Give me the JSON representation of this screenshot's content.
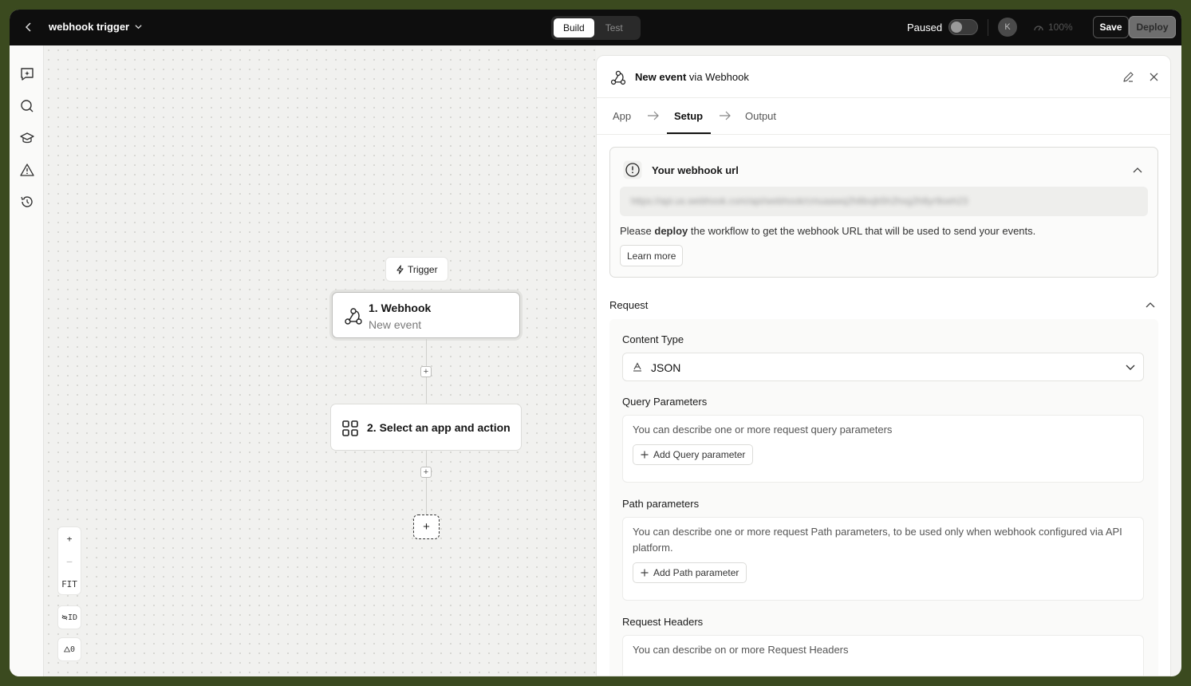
{
  "topbar": {
    "workflow_title": "webhook trigger",
    "modes": [
      "Build",
      "Test"
    ],
    "active_mode": "Build",
    "paused_label": "Paused",
    "paused": false,
    "avatar_initial": "K",
    "zoom_level": "100%",
    "save_label": "Save",
    "deploy_label": "Deploy"
  },
  "rail": {
    "items": [
      "ai-chat-icon",
      "search-icon",
      "learn-icon",
      "warning-icon",
      "history-icon"
    ]
  },
  "canvas": {
    "trigger_chip": "Trigger",
    "nodes": [
      {
        "title": "1. Webhook",
        "subtitle": "New event"
      },
      {
        "title": "2. Select an app and action",
        "subtitle": ""
      }
    ],
    "plus": "+",
    "controls": {
      "zoom_in": "+",
      "zoom_out": "—",
      "fit": "FIT",
      "id_toggle": "ID",
      "warnings": "0"
    }
  },
  "panel": {
    "title_prefix": "New event",
    "title_via": " via ",
    "title_app": "Webhook",
    "tabs": [
      "App",
      "Setup",
      "Output"
    ],
    "active_tab": "Setup",
    "webhook": {
      "heading": "Your webhook url",
      "url_masked": "https://api.us.webhook.com/api/webhook/cmuaawq2h8bxjb5h2hxg2h8yr9oeh23",
      "desc_before": "Please ",
      "desc_bold": "deploy",
      "desc_after": " the workflow to get the webhook URL that will be used to send your events.",
      "learn_more": "Learn more"
    },
    "request": {
      "heading": "Request",
      "content_type_label": "Content Type",
      "content_type_value": "JSON",
      "query": {
        "label": "Query Parameters",
        "desc": "You can describe one or more request query parameters",
        "button": "Add Query parameter"
      },
      "path": {
        "label": "Path parameters",
        "desc": "You can describe one or more request Path parameters, to be used only when webhook configured via API platform.",
        "button": "Add Path parameter"
      },
      "headers": {
        "label": "Request Headers",
        "desc": "You can describe on or more Request Headers"
      }
    }
  }
}
